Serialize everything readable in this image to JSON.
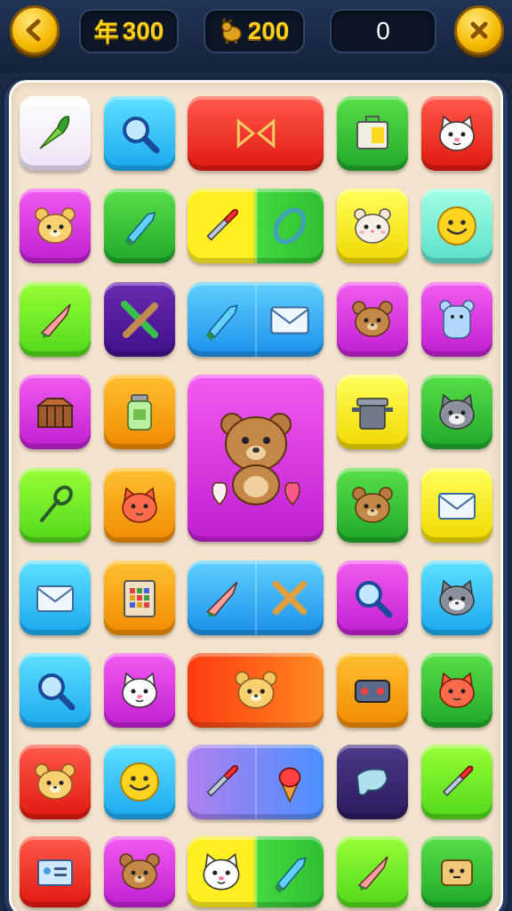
{
  "header": {
    "coins": "300",
    "coin_symbol": "年",
    "energy": "200",
    "score": "0",
    "back_icon": "chevron-left-icon",
    "close_icon": "close-icon"
  },
  "board": {
    "rows": [
      [
        "carrot-icon",
        "magnifier-icon",
        "bow-icon",
        "lunchbox-icon",
        "cat-face-icon"
      ],
      [
        "cat-face-icon",
        "crystal-icon",
        "paintbrush-and-ring-icons",
        "hamster-face-icon",
        "smiley-icon"
      ],
      [
        "crayon-icon",
        "crossed-sticks-icon",
        "crystal-and-envelope-icons",
        "bear-face-icon",
        "mouse-doll-icon"
      ],
      [
        "treasure-chest-icon",
        "jar-icon",
        "teddy-bear-with-hearts-icon",
        "pot-icon",
        "cat-face-icon"
      ],
      [
        "slingshot-icon",
        "cat-face-icon",
        "",
        "hamster-face-icon",
        "envelope-icon"
      ],
      [
        "envelope-icon",
        "abacus-icon",
        "crayon-and-cross-icons",
        "magnifier-icon",
        "cat-face-icon"
      ],
      [
        "magnifier-icon",
        "cat-face-icon",
        "hamster-face-icon",
        "radio-icon",
        "cat-face-icon"
      ],
      [
        "bear-face-icon",
        "smiley-icon",
        "paintbrush-and-ice-cream-icons",
        "nail-icon",
        "paintbrush-icon"
      ],
      [
        "card-icon",
        "bear-face-icon",
        "cat-face-and-crystal-icons",
        "crayon-icon",
        "toast-face-icon"
      ]
    ]
  },
  "colors": {
    "gold": "#ffd21a",
    "board_bg": "#f3e3cd",
    "frame": "#233a61"
  }
}
